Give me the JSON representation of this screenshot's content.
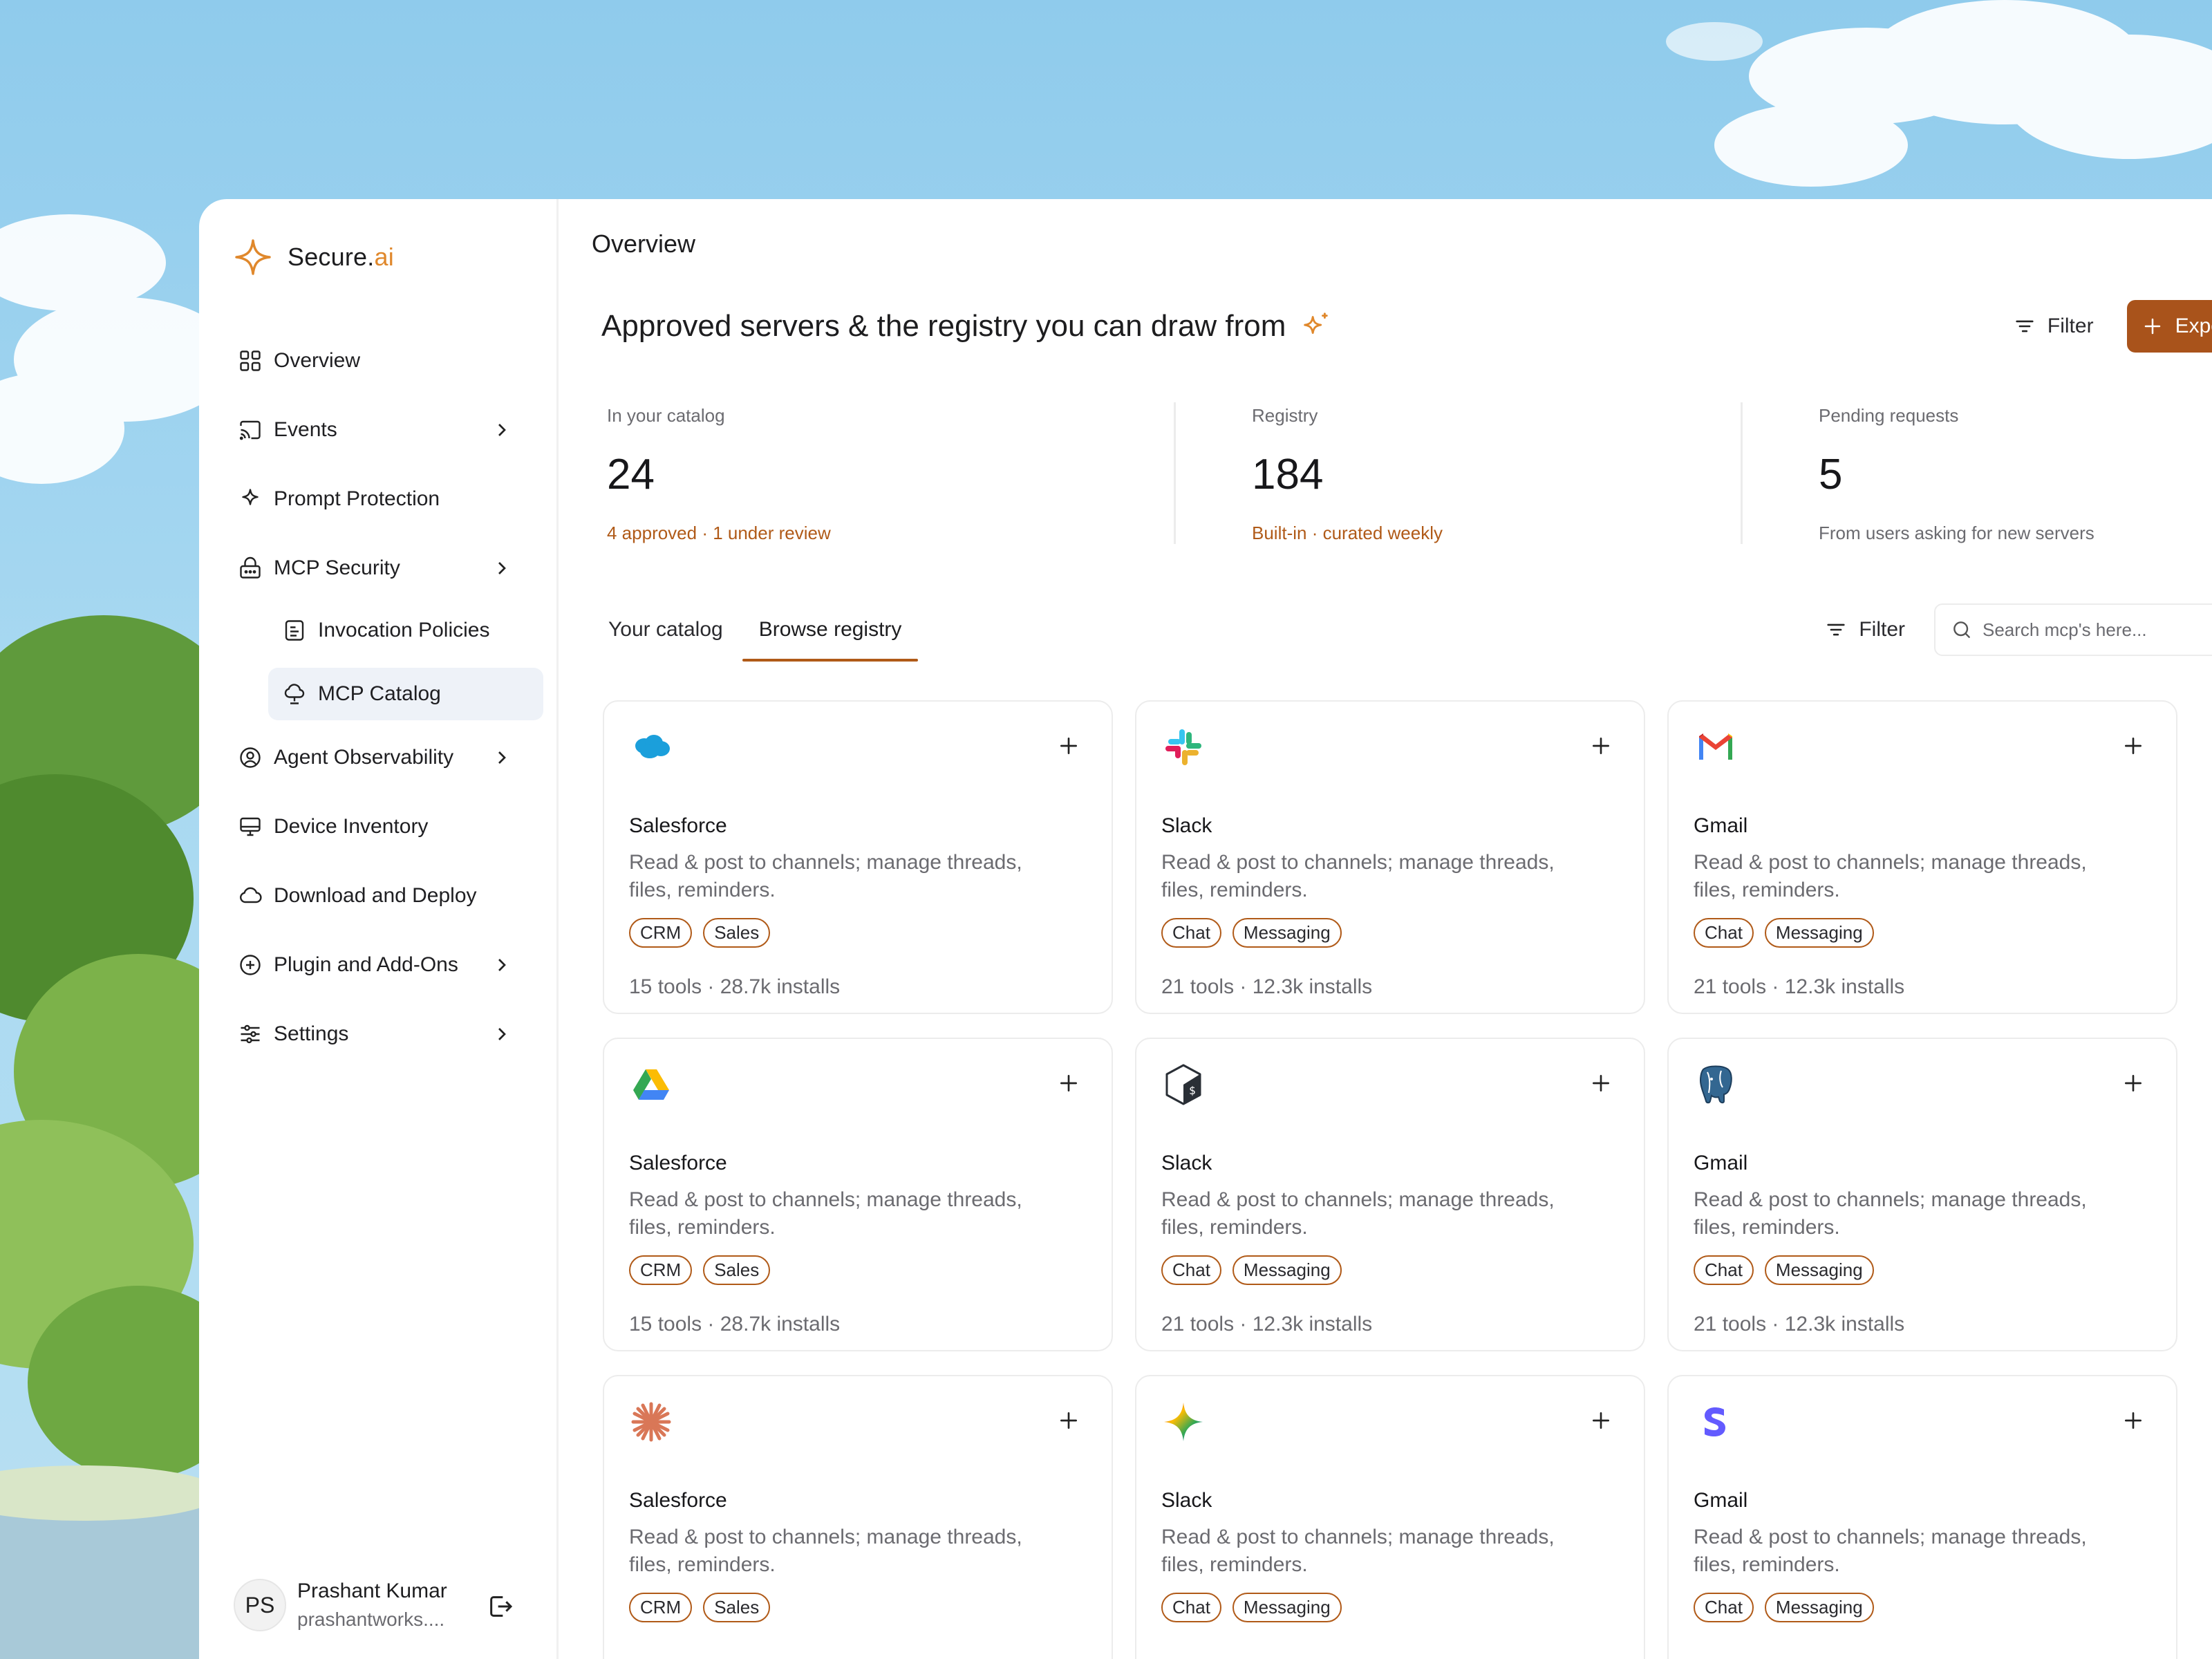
{
  "brand": {
    "name": "Secure.",
    "suffix": "ai"
  },
  "sidebar": {
    "items": [
      {
        "label": "Overview"
      },
      {
        "label": "Events"
      },
      {
        "label": "Prompt Protection"
      },
      {
        "label": "MCP Security"
      },
      {
        "label": "Invocation Policies"
      },
      {
        "label": "MCP Catalog"
      },
      {
        "label": "Agent Observability"
      },
      {
        "label": "Device Inventory"
      },
      {
        "label": "Download and Deploy"
      },
      {
        "label": "Plugin and Add-Ons"
      },
      {
        "label": "Settings"
      }
    ],
    "user": {
      "initials": "PS",
      "name": "Prashant Kumar",
      "email": "prashantworks...."
    }
  },
  "header": {
    "title": "Overview",
    "headline": "Approved servers & the registry you can draw from",
    "filter_label": "Filter",
    "export_label": "Export report"
  },
  "stats": [
    {
      "label": "In your catalog",
      "value": "24",
      "sub": "4 approved · 1 under review"
    },
    {
      "label": "Registry",
      "value": "184",
      "sub": "Built-in · curated weekly"
    },
    {
      "label": "Pending requests",
      "value": "5",
      "sub": "From users asking for new servers"
    }
  ],
  "tabs": [
    {
      "label": "Your catalog"
    },
    {
      "label": "Browse registry"
    }
  ],
  "toolbar": {
    "filter_label": "Filter",
    "search_placeholder": "Search mcp's here..."
  },
  "cards": [
    {
      "icon": "salesforce-icon",
      "title": "Salesforce",
      "desc": "Read & post to channels; manage threads, files, reminders.",
      "tags": [
        "CRM",
        "Sales"
      ],
      "meta": "15 tools · 28.7k installs"
    },
    {
      "icon": "slack-icon",
      "title": "Slack",
      "desc": "Read & post to channels; manage threads, files, reminders.",
      "tags": [
        "Chat",
        "Messaging"
      ],
      "meta": "21 tools · 12.3k installs"
    },
    {
      "icon": "gmail-icon",
      "title": "Gmail",
      "desc": "Read & post to channels; manage threads, files, reminders.",
      "tags": [
        "Chat",
        "Messaging"
      ],
      "meta": "21 tools · 12.3k installs"
    },
    {
      "icon": "google-drive-icon",
      "title": "Salesforce",
      "desc": "Read & post to channels; manage threads, files, reminders.",
      "tags": [
        "CRM",
        "Sales"
      ],
      "meta": "15 tools · 28.7k installs"
    },
    {
      "icon": "terminal-cube-icon",
      "title": "Slack",
      "desc": "Read & post to channels; manage threads, files, reminders.",
      "tags": [
        "Chat",
        "Messaging"
      ],
      "meta": "21 tools · 12.3k installs"
    },
    {
      "icon": "postgresql-icon",
      "title": "Gmail",
      "desc": "Read & post to channels; manage threads, files, reminders.",
      "tags": [
        "Chat",
        "Messaging"
      ],
      "meta": "21 tools · 12.3k installs"
    },
    {
      "icon": "claude-burst-icon",
      "title": "Salesforce",
      "desc": "Read & post to channels; manage threads, files, reminders.",
      "tags": [
        "CRM",
        "Sales"
      ],
      "meta": ""
    },
    {
      "icon": "gemini-sparkle-icon",
      "title": "Slack",
      "desc": "Read & post to channels; manage threads, files, reminders.",
      "tags": [
        "Chat",
        "Messaging"
      ],
      "meta": ""
    },
    {
      "icon": "stripe-icon",
      "title": "Gmail",
      "desc": "Read & post to channels; manage threads, files, reminders.",
      "tags": [
        "Chat",
        "Messaging"
      ],
      "meta": ""
    }
  ],
  "colors": {
    "accent": "#a9531b",
    "accent_text": "#b05a18",
    "brand_orange": "#e0882c"
  }
}
